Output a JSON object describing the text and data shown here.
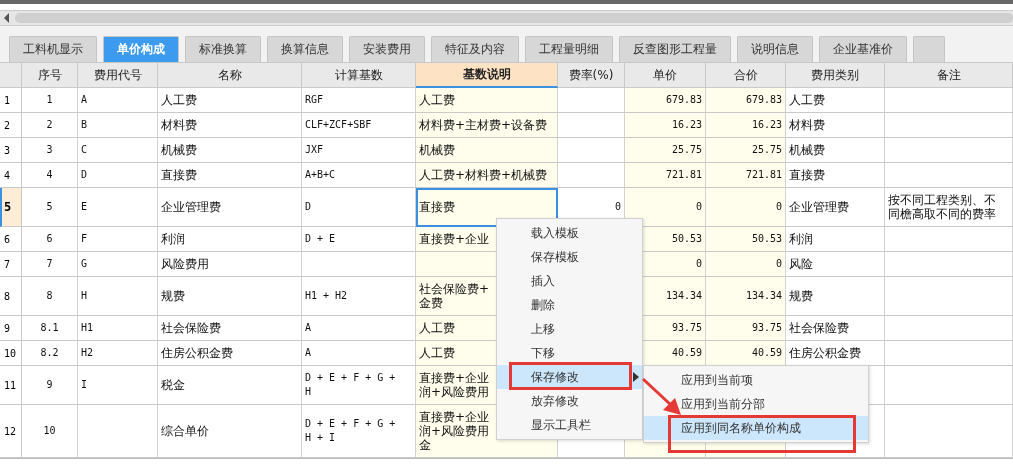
{
  "tabs": [
    {
      "label": "工料机显示",
      "selected": false
    },
    {
      "label": "单价构成",
      "selected": true
    },
    {
      "label": "标准换算",
      "selected": false
    },
    {
      "label": "换算信息",
      "selected": false
    },
    {
      "label": "安装费用",
      "selected": false
    },
    {
      "label": "特征及内容",
      "selected": false
    },
    {
      "label": "工程量明细",
      "selected": false
    },
    {
      "label": "反查图形工程量",
      "selected": false
    },
    {
      "label": "说明信息",
      "selected": false
    },
    {
      "label": "企业基准价",
      "selected": false
    }
  ],
  "table": {
    "columns": [
      {
        "label": "序号",
        "selected": false,
        "shaded": false
      },
      {
        "label": "费用代号",
        "selected": false,
        "shaded": false
      },
      {
        "label": "名称",
        "selected": false,
        "shaded": false
      },
      {
        "label": "计算基数",
        "selected": false,
        "shaded": false
      },
      {
        "label": "基数说明",
        "selected": true,
        "shaded": true
      },
      {
        "label": "费率(%)",
        "selected": false,
        "shaded": false
      },
      {
        "label": "单价",
        "selected": false,
        "shaded": true
      },
      {
        "label": "合价",
        "selected": false,
        "shaded": true
      },
      {
        "label": "费用类别",
        "selected": false,
        "shaded": false
      },
      {
        "label": "备注",
        "selected": false,
        "shaded": false
      }
    ],
    "rows": [
      {
        "number": "1",
        "current": false,
        "cells": [
          "1",
          "A",
          "人工费",
          "RGF",
          "人工费",
          "",
          "679.83",
          "679.83",
          "人工费",
          ""
        ]
      },
      {
        "number": "2",
        "current": false,
        "cells": [
          "2",
          "B",
          "材料费",
          "CLF+ZCF+SBF",
          "材料费+主材费+设备费",
          "",
          "16.23",
          "16.23",
          "材料费",
          ""
        ]
      },
      {
        "number": "3",
        "current": false,
        "cells": [
          "3",
          "C",
          "机械费",
          "JXF",
          "机械费",
          "",
          "25.75",
          "25.75",
          "机械费",
          ""
        ]
      },
      {
        "number": "4",
        "current": false,
        "cells": [
          "4",
          "D",
          "直接费",
          "A+B+C",
          "人工费+材料费+机械费",
          "",
          "721.81",
          "721.81",
          "直接费",
          ""
        ]
      },
      {
        "number": "5",
        "current": true,
        "cells": [
          "5",
          "E",
          "企业管理费",
          "D",
          "直接费",
          "0",
          "0",
          "0",
          "企业管理费",
          "按不同工程类别、不同檐高取不同的费率"
        ]
      },
      {
        "number": "6",
        "current": false,
        "cells": [
          "6",
          "F",
          "利润",
          "D + E",
          "直接费+企业",
          "",
          "50.53",
          "50.53",
          "利润",
          ""
        ]
      },
      {
        "number": "7",
        "current": false,
        "cells": [
          "7",
          "G",
          "风险费用",
          "",
          "",
          "",
          "0",
          "0",
          "风险",
          ""
        ]
      },
      {
        "number": "8",
        "current": false,
        "cells": [
          "8",
          "H",
          "规费",
          "H1 + H2",
          [
            "社会保险费+",
            "金费"
          ],
          "",
          "134.34",
          "134.34",
          "规费",
          ""
        ]
      },
      {
        "number": "9",
        "current": false,
        "cells": [
          "8.1",
          "H1",
          "社会保险费",
          "A",
          "人工费",
          "",
          "93.75",
          "93.75",
          "社会保险费",
          ""
        ]
      },
      {
        "number": "10",
        "current": false,
        "cells": [
          "8.2",
          "H2",
          "住房公积金费",
          "A",
          "人工费",
          "",
          "40.59",
          "40.59",
          "住房公积金费",
          ""
        ]
      },
      {
        "number": "11",
        "current": false,
        "cells": [
          "9",
          "I",
          "税金",
          "D + E + F + G +\nH",
          [
            "直接费+企业",
            "润+风险费用"
          ],
          "",
          "",
          "",
          "",
          ""
        ]
      },
      {
        "number": "12",
        "current": false,
        "cells": [
          "10",
          "",
          "综合单价",
          "D + E + F + G +\nH + I",
          [
            "直接费+企业",
            "润+风险费用",
            "金"
          ],
          "",
          "",
          "",
          "",
          ""
        ]
      }
    ]
  },
  "context_menu": {
    "items": [
      {
        "label": "载入模板",
        "selected": false,
        "submenu": false,
        "highlighted": false
      },
      {
        "label": "保存模板",
        "selected": false,
        "submenu": false,
        "highlighted": false
      },
      {
        "label": "插入",
        "selected": false,
        "submenu": false,
        "highlighted": false
      },
      {
        "label": "删除",
        "selected": false,
        "submenu": false,
        "highlighted": false
      },
      {
        "label": "上移",
        "selected": false,
        "submenu": false,
        "highlighted": false
      },
      {
        "label": "下移",
        "selected": false,
        "submenu": false,
        "highlighted": false
      },
      {
        "label": "保存修改",
        "selected": true,
        "submenu": true,
        "highlighted": true
      },
      {
        "label": "放弃修改",
        "selected": false,
        "submenu": false,
        "highlighted": false
      },
      {
        "label": "显示工具栏",
        "selected": false,
        "submenu": false,
        "highlighted": false
      }
    ]
  },
  "submenu": {
    "items": [
      {
        "label": "应用到当前项",
        "selected": false,
        "highlighted": false
      },
      {
        "label": "应用到当前分部",
        "selected": false,
        "highlighted": false
      },
      {
        "label": "应用到同名称单价构成",
        "selected": true,
        "highlighted": true
      }
    ]
  }
}
